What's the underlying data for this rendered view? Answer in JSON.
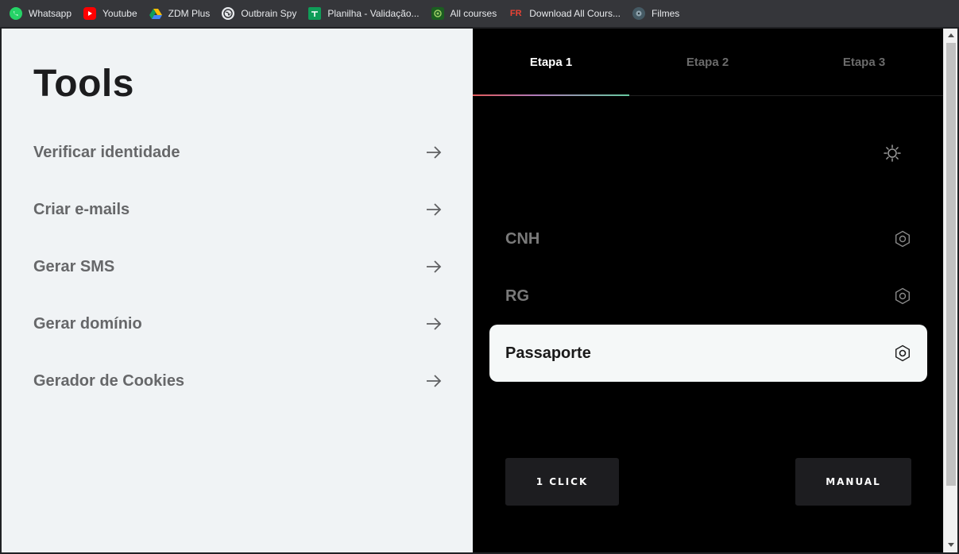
{
  "bookmarks": [
    {
      "label": "Whatsapp",
      "icon": "whatsapp-icon"
    },
    {
      "label": "Youtube",
      "icon": "youtube-icon"
    },
    {
      "label": "ZDM Plus",
      "icon": "drive-icon"
    },
    {
      "label": "Outbrain Spy",
      "icon": "globe-icon"
    },
    {
      "label": "Planilha - Validação...",
      "icon": "sheets-icon"
    },
    {
      "label": "All courses",
      "icon": "courses-icon"
    },
    {
      "label": "Download All Cours...",
      "icon": "fr-icon",
      "icon_text": "FR"
    },
    {
      "label": "Filmes",
      "icon": "film-icon"
    }
  ],
  "tools": {
    "title": "Tools",
    "items": [
      {
        "label": "Verificar identidade"
      },
      {
        "label": "Criar e-mails"
      },
      {
        "label": "Gerar SMS"
      },
      {
        "label": "Gerar domínio"
      },
      {
        "label": "Gerador de Cookies"
      }
    ]
  },
  "panel": {
    "tabs": [
      {
        "label": "Etapa 1",
        "active": true
      },
      {
        "label": "Etapa 2",
        "active": false
      },
      {
        "label": "Etapa 3",
        "active": false
      }
    ],
    "documents": [
      {
        "label": "CNH",
        "selected": false
      },
      {
        "label": "RG",
        "selected": false
      },
      {
        "label": "Passaporte",
        "selected": true
      }
    ],
    "buttons": {
      "one_click": "1 CLICK",
      "manual": "MANUAL"
    }
  },
  "colors": {
    "left_bg": "#f0f3f5",
    "right_bg": "#000000",
    "selected_bg": "#f5f8f8",
    "button_bg": "#1d1d20",
    "tab_gradient_start": "#e25b5b",
    "tab_gradient_end": "#66c9a0"
  }
}
